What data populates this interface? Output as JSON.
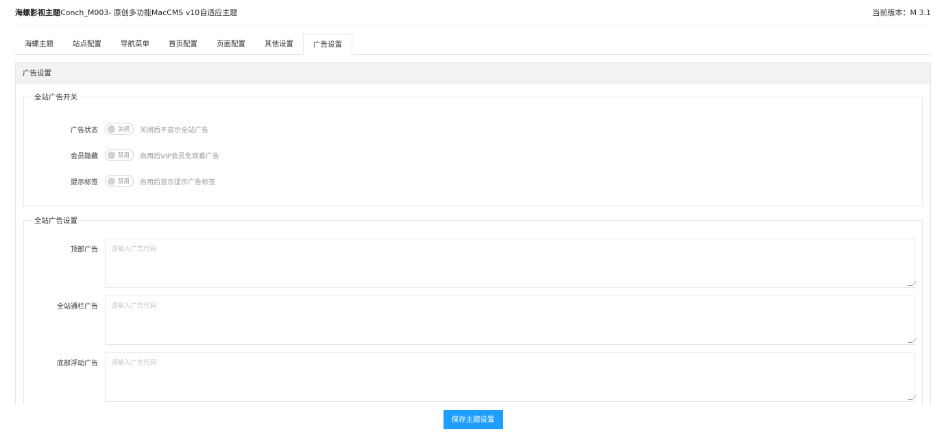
{
  "header": {
    "brand_bold": "海螺影视主题",
    "brand_rest": "Conch_M003- 原创多功能MacCMS v10自适应主题",
    "version": "当前版本：M 3.1"
  },
  "tabs": [
    {
      "label": "海螺主题",
      "active": false
    },
    {
      "label": "站点配置",
      "active": false
    },
    {
      "label": "导航菜单",
      "active": false
    },
    {
      "label": "首页配置",
      "active": false
    },
    {
      "label": "页面配置",
      "active": false
    },
    {
      "label": "其他设置",
      "active": false
    },
    {
      "label": "广告设置",
      "active": true
    }
  ],
  "panel": {
    "title": "广告设置",
    "switch_section": {
      "legend": "全站广告开关",
      "rows": [
        {
          "label": "广告状态",
          "switch_text": "关闭",
          "hint": "关闭后不显示全站广告"
        },
        {
          "label": "会员隐藏",
          "switch_text": "禁用",
          "hint": "启用后VIP会员免观看广告"
        },
        {
          "label": "提示标签",
          "switch_text": "禁用",
          "hint": "启用后显示提示广告标签"
        }
      ]
    },
    "ad_section": {
      "legend": "全站广告设置",
      "fields": [
        {
          "label": "顶部广告",
          "placeholder": "请输入广告代码"
        },
        {
          "label": "全站通栏广告",
          "placeholder": "请输入广告代码"
        },
        {
          "label": "底部浮动广告",
          "placeholder": "请输入广告代码"
        }
      ]
    }
  },
  "footer": {
    "save_label": "保存主题设置"
  },
  "colors": {
    "primary": "#1e9fff",
    "panel_head_bg": "#f2f2f2",
    "border": "#e6e6e6"
  }
}
